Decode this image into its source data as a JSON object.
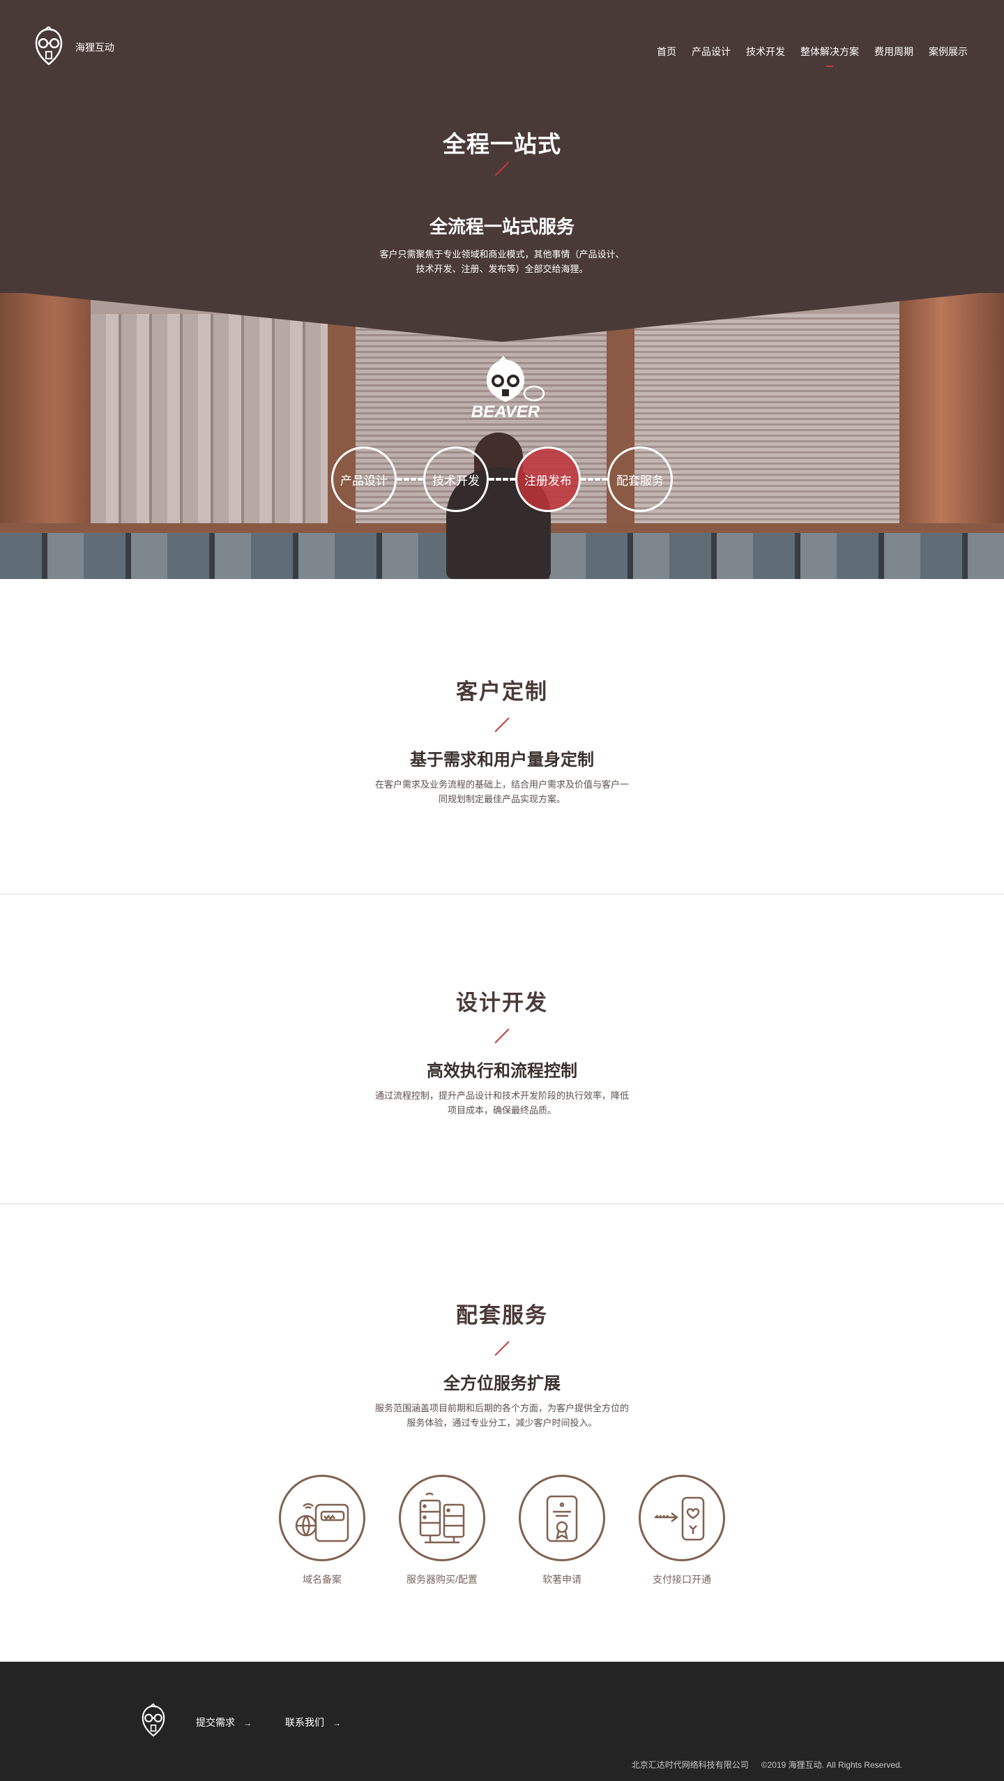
{
  "nav": {
    "logo_text": "海狸互动",
    "items": [
      {
        "label": "首页"
      },
      {
        "label": "产品设计"
      },
      {
        "label": "技术开发"
      },
      {
        "label": "整体解决方案"
      },
      {
        "label": "费用周期"
      },
      {
        "label": "案例展示"
      }
    ]
  },
  "hero": {
    "title": "全程一站式",
    "subtitle": "全流程一站式服务",
    "description": "客户只需聚焦于专业领域和商业模式，其他事情（产品设计、技术开发、注册、发布等）全部交给海狸。",
    "steps": [
      {
        "label": "产品设计"
      },
      {
        "label": "技术开发"
      },
      {
        "label": "注册发布"
      },
      {
        "label": "配套服务"
      }
    ]
  },
  "sections": [
    {
      "title": "客户定制",
      "subtitle": "基于需求和用户量身定制",
      "description": "在客户需求及业务流程的基础上，结合用户需求及价值与客户一同规划制定最佳产品实现方案。"
    },
    {
      "title": "设计开发",
      "subtitle": "高效执行和流程控制",
      "description": "通过流程控制，提升产品设计和技术开发阶段的执行效率，降低项目成本，确保最终品质。"
    },
    {
      "title": "配套服务",
      "subtitle": "全方位服务扩展",
      "description": "服务范围涵盖项目前期和后期的各个方面，为客户提供全方位的服务体验，通过专业分工，减少客户时间投入。"
    }
  ],
  "services": [
    {
      "label": "域名备案",
      "icon": "domain-icon"
    },
    {
      "label": "服务器购买/配置",
      "icon": "server-icon"
    },
    {
      "label": "软著申请",
      "icon": "certificate-icon"
    },
    {
      "label": "支付接口开通",
      "icon": "payment-icon"
    }
  ],
  "footer": {
    "links": [
      {
        "label": "提交需求",
        "arrow": "→"
      },
      {
        "label": "联系我们",
        "arrow": "→"
      }
    ],
    "company": "北京汇达时代网络科技有限公司",
    "copyright": "©2019 海狸互动. All Rights Reserved."
  },
  "colors": {
    "brand_dark": "#4a3a37",
    "accent_red": "#c0393b",
    "footer_bg": "#252424",
    "icon_brown": "#806050"
  }
}
